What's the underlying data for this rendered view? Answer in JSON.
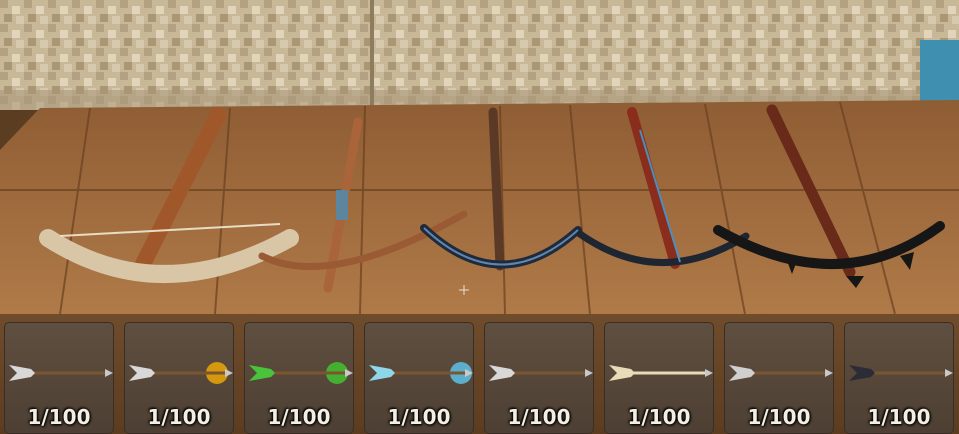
{
  "scene": {
    "crossbows": [
      {
        "icon": "bone-crossbow-icon",
        "color": "#d8c6a6"
      },
      {
        "icon": "wooden-crossbow-icon",
        "color": "#a9643a"
      },
      {
        "icon": "blackmetal-crossbow-icon",
        "color": "#1f2a3a"
      },
      {
        "icon": "red-crossbow-icon",
        "color": "#8a2d1c"
      },
      {
        "icon": "dark-spiked-crossbow-icon",
        "color": "#161616"
      }
    ]
  },
  "hotbar": {
    "slots": [
      {
        "count": "1/100",
        "icon": "arrow-icon",
        "tip": "#d8d8d8",
        "effect": "none"
      },
      {
        "count": "1/100",
        "icon": "fire-arrow-icon",
        "tip": "#d8d8d8",
        "effect": "#ffb300"
      },
      {
        "count": "1/100",
        "icon": "poison-arrow-icon",
        "tip": "#49c43a",
        "effect": "#3fd12e"
      },
      {
        "count": "1/100",
        "icon": "frost-arrow-icon",
        "tip": "#8fd6e8",
        "effect": "#5fd0ff"
      },
      {
        "count": "1/100",
        "icon": "silver-arrow-icon",
        "tip": "#d8d8d8",
        "effect": "none"
      },
      {
        "count": "1/100",
        "icon": "bone-arrow-icon",
        "tip": "#e8dcb8",
        "effect": "none"
      },
      {
        "count": "1/100",
        "icon": "needle-arrow-icon",
        "tip": "#cfcfcf",
        "effect": "none"
      },
      {
        "count": "1/100",
        "icon": "carapace-arrow-icon",
        "tip": "#2c2c36",
        "effect": "none"
      }
    ]
  }
}
